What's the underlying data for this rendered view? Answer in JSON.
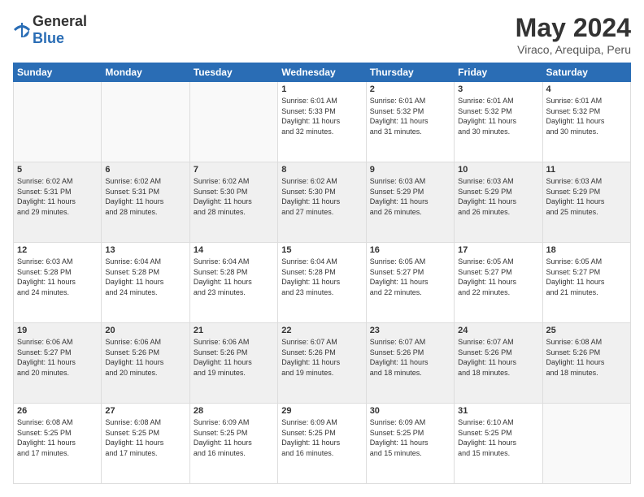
{
  "logo": {
    "general": "General",
    "blue": "Blue"
  },
  "title": "May 2024",
  "location": "Viraco, Arequipa, Peru",
  "weekdays": [
    "Sunday",
    "Monday",
    "Tuesday",
    "Wednesday",
    "Thursday",
    "Friday",
    "Saturday"
  ],
  "weeks": [
    [
      {
        "day": "",
        "info": ""
      },
      {
        "day": "",
        "info": ""
      },
      {
        "day": "",
        "info": ""
      },
      {
        "day": "1",
        "info": "Sunrise: 6:01 AM\nSunset: 5:33 PM\nDaylight: 11 hours\nand 32 minutes."
      },
      {
        "day": "2",
        "info": "Sunrise: 6:01 AM\nSunset: 5:32 PM\nDaylight: 11 hours\nand 31 minutes."
      },
      {
        "day": "3",
        "info": "Sunrise: 6:01 AM\nSunset: 5:32 PM\nDaylight: 11 hours\nand 30 minutes."
      },
      {
        "day": "4",
        "info": "Sunrise: 6:01 AM\nSunset: 5:32 PM\nDaylight: 11 hours\nand 30 minutes."
      }
    ],
    [
      {
        "day": "5",
        "info": "Sunrise: 6:02 AM\nSunset: 5:31 PM\nDaylight: 11 hours\nand 29 minutes."
      },
      {
        "day": "6",
        "info": "Sunrise: 6:02 AM\nSunset: 5:31 PM\nDaylight: 11 hours\nand 28 minutes."
      },
      {
        "day": "7",
        "info": "Sunrise: 6:02 AM\nSunset: 5:30 PM\nDaylight: 11 hours\nand 28 minutes."
      },
      {
        "day": "8",
        "info": "Sunrise: 6:02 AM\nSunset: 5:30 PM\nDaylight: 11 hours\nand 27 minutes."
      },
      {
        "day": "9",
        "info": "Sunrise: 6:03 AM\nSunset: 5:29 PM\nDaylight: 11 hours\nand 26 minutes."
      },
      {
        "day": "10",
        "info": "Sunrise: 6:03 AM\nSunset: 5:29 PM\nDaylight: 11 hours\nand 26 minutes."
      },
      {
        "day": "11",
        "info": "Sunrise: 6:03 AM\nSunset: 5:29 PM\nDaylight: 11 hours\nand 25 minutes."
      }
    ],
    [
      {
        "day": "12",
        "info": "Sunrise: 6:03 AM\nSunset: 5:28 PM\nDaylight: 11 hours\nand 24 minutes."
      },
      {
        "day": "13",
        "info": "Sunrise: 6:04 AM\nSunset: 5:28 PM\nDaylight: 11 hours\nand 24 minutes."
      },
      {
        "day": "14",
        "info": "Sunrise: 6:04 AM\nSunset: 5:28 PM\nDaylight: 11 hours\nand 23 minutes."
      },
      {
        "day": "15",
        "info": "Sunrise: 6:04 AM\nSunset: 5:28 PM\nDaylight: 11 hours\nand 23 minutes."
      },
      {
        "day": "16",
        "info": "Sunrise: 6:05 AM\nSunset: 5:27 PM\nDaylight: 11 hours\nand 22 minutes."
      },
      {
        "day": "17",
        "info": "Sunrise: 6:05 AM\nSunset: 5:27 PM\nDaylight: 11 hours\nand 22 minutes."
      },
      {
        "day": "18",
        "info": "Sunrise: 6:05 AM\nSunset: 5:27 PM\nDaylight: 11 hours\nand 21 minutes."
      }
    ],
    [
      {
        "day": "19",
        "info": "Sunrise: 6:06 AM\nSunset: 5:27 PM\nDaylight: 11 hours\nand 20 minutes."
      },
      {
        "day": "20",
        "info": "Sunrise: 6:06 AM\nSunset: 5:26 PM\nDaylight: 11 hours\nand 20 minutes."
      },
      {
        "day": "21",
        "info": "Sunrise: 6:06 AM\nSunset: 5:26 PM\nDaylight: 11 hours\nand 19 minutes."
      },
      {
        "day": "22",
        "info": "Sunrise: 6:07 AM\nSunset: 5:26 PM\nDaylight: 11 hours\nand 19 minutes."
      },
      {
        "day": "23",
        "info": "Sunrise: 6:07 AM\nSunset: 5:26 PM\nDaylight: 11 hours\nand 18 minutes."
      },
      {
        "day": "24",
        "info": "Sunrise: 6:07 AM\nSunset: 5:26 PM\nDaylight: 11 hours\nand 18 minutes."
      },
      {
        "day": "25",
        "info": "Sunrise: 6:08 AM\nSunset: 5:26 PM\nDaylight: 11 hours\nand 18 minutes."
      }
    ],
    [
      {
        "day": "26",
        "info": "Sunrise: 6:08 AM\nSunset: 5:25 PM\nDaylight: 11 hours\nand 17 minutes."
      },
      {
        "day": "27",
        "info": "Sunrise: 6:08 AM\nSunset: 5:25 PM\nDaylight: 11 hours\nand 17 minutes."
      },
      {
        "day": "28",
        "info": "Sunrise: 6:09 AM\nSunset: 5:25 PM\nDaylight: 11 hours\nand 16 minutes."
      },
      {
        "day": "29",
        "info": "Sunrise: 6:09 AM\nSunset: 5:25 PM\nDaylight: 11 hours\nand 16 minutes."
      },
      {
        "day": "30",
        "info": "Sunrise: 6:09 AM\nSunset: 5:25 PM\nDaylight: 11 hours\nand 15 minutes."
      },
      {
        "day": "31",
        "info": "Sunrise: 6:10 AM\nSunset: 5:25 PM\nDaylight: 11 hours\nand 15 minutes."
      },
      {
        "day": "",
        "info": ""
      }
    ]
  ]
}
